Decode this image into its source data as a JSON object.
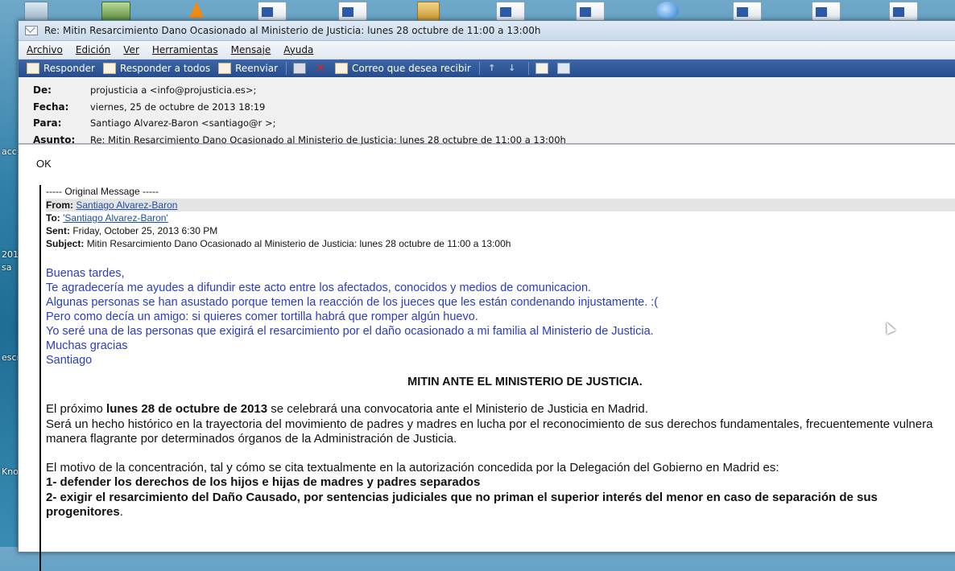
{
  "desktop": {
    "labels": [
      "acc",
      "201",
      "sa",
      "escr",
      "Kno"
    ]
  },
  "window": {
    "title": "Re: Mitin Resarcimiento Dano Ocasionado al Ministerio de Justicia: lunes 28 octubre de 11:00 a 13:00h"
  },
  "menu": [
    "Archivo",
    "Edición",
    "Ver",
    "Herramientas",
    "Mensaje",
    "Ayuda"
  ],
  "toolbar": {
    "reply": "Responder",
    "reply_all": "Responder a todos",
    "forward": "Reenviar",
    "wanted_mail": "Correo que desea recibir"
  },
  "headers": {
    "from_label": "De:",
    "from_value": "projusticia a <info@projusticia.es>;",
    "date_label": "Fecha:",
    "date_value": "viernes, 25 de octubre de 2013 18:19",
    "to_label": "Para:",
    "to_value": "Santiago Alvarez-Baron <santiago@r           >;",
    "subject_label": "Asunto:",
    "subject_value": "Re: Mitin Resarcimiento Dano Ocasionado al Ministerio de Justicia: lunes 28 octubre de 11:00 a 13:00h"
  },
  "body": {
    "reply_text": "OK",
    "original_header": "----- Original Message -----",
    "o_from_label": "From:",
    "o_from_value": "Santiago Alvarez-Baron",
    "o_to_label": "To:",
    "o_to_value": "'Santiago Alvarez-Baron'",
    "o_sent_label": "Sent:",
    "o_sent_value": "Friday, October 25, 2013 6:30 PM",
    "o_subject_label": "Subject:",
    "o_subject_value": "Mitin Resarcimiento Dano Ocasionado al Ministerio de Justicia: lunes 28 octubre de 11:00 a 13:00h",
    "blue_lines": [
      "Buenas tardes,",
      "Te agradecería me ayudes a difundir este acto entre los afectados, conocidos y medios de comunicacion.",
      "Algunas personas se han asustado porque temen la reacción de los jueces que les están condenando injustamente. :(",
      "Pero como decía un amigo: si quieres comer tortilla habrá que romper algún huevo.",
      "Yo seré una de las personas que exigirá el resarcimiento por el daño ocasionado a mi familia al Ministerio de Justicia.",
      "Muchas gracias",
      "Santiago"
    ],
    "title": "MITIN ANTE EL MINISTERIO DE JUSTICIA.",
    "p1_a": "El próximo ",
    "p1_b": "lunes 28 de octubre de 2013",
    "p1_c": " se celebrará una convocatoria ante el Ministerio de Justicia en Madrid.",
    "p1_line2": "Será un hecho histórico en la trayectoria del movimiento de padres y madres en lucha por el reconocimiento de sus derechos fundamentales, frecuentemente vulnera",
    "p1_line3": "manera flagrante por determinados órganos de la Administración de Justicia.",
    "p2_line1": "El motivo de la concentración, tal y cómo se cita textualmente en la autorización concedida por la Delegación del Gobierno en Madrid es:",
    "p2_line2": "1- defender los derechos de los hijos e hijas de madres y padres separados",
    "p2_line3": "2- exigir el resarcimiento del Daño Causado, por sentencias judiciales que no priman el superior interés del menor en caso de separación de sus",
    "p2_line4": "progenitores",
    "p2_line4_end": "."
  }
}
